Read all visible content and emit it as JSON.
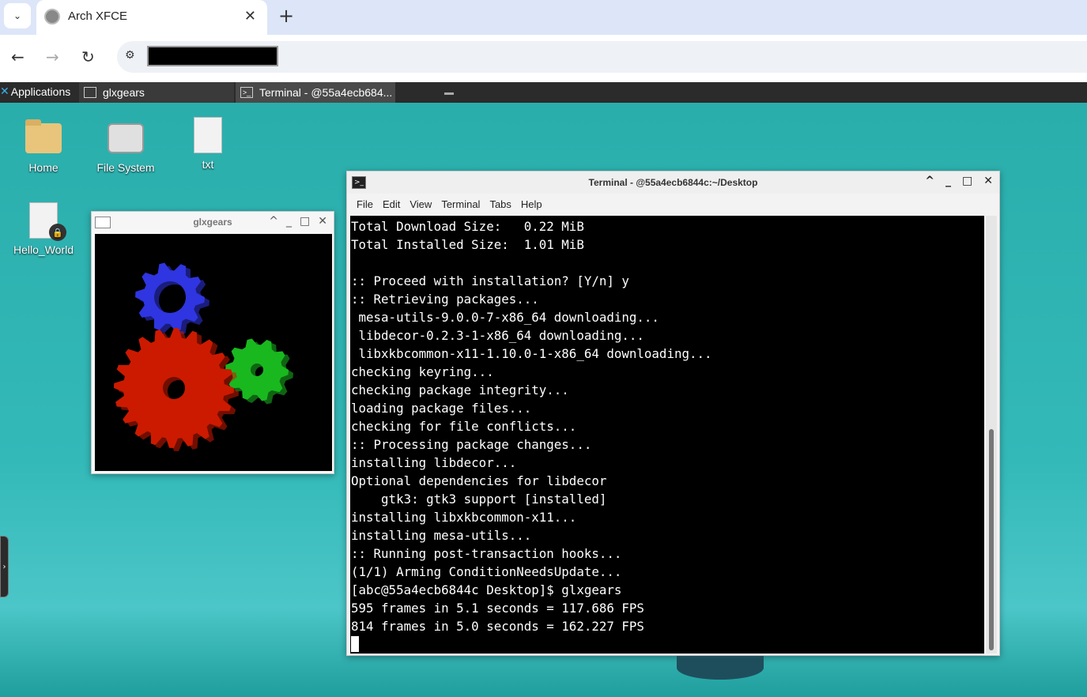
{
  "browser": {
    "tab_title": "Arch XFCE",
    "tab_close": "✕",
    "new_tab": "+",
    "tab_search": "⌄",
    "back": "←",
    "forward": "→",
    "reload": "↻",
    "site_info": "⚙"
  },
  "panel": {
    "applications_label": "Applications",
    "tasks": [
      {
        "label": "glxgears"
      },
      {
        "label": "Terminal - @55a4ecb684..."
      }
    ]
  },
  "desktop": {
    "icons": [
      {
        "label": "Home"
      },
      {
        "label": "File System"
      },
      {
        "label": "txt"
      },
      {
        "label": "Hello_World"
      }
    ]
  },
  "glxgears_window": {
    "title": "glxgears",
    "controls": [
      "^",
      "_",
      "□",
      "✕"
    ]
  },
  "terminal_window": {
    "title": "Terminal - @55a4ecb6844c:~/Desktop",
    "controls": [
      "^",
      "_",
      "□",
      "✕"
    ],
    "menu": [
      "File",
      "Edit",
      "View",
      "Terminal",
      "Tabs",
      "Help"
    ],
    "lines": [
      "Total Download Size:   0.22 MiB",
      "Total Installed Size:  1.01 MiB",
      "",
      ":: Proceed with installation? [Y/n] y",
      ":: Retrieving packages...",
      " mesa-utils-9.0.0-7-x86_64 downloading...",
      " libdecor-0.2.3-1-x86_64 downloading...",
      " libxkbcommon-x11-1.10.0-1-x86_64 downloading...",
      "checking keyring...",
      "checking package integrity...",
      "loading package files...",
      "checking for file conflicts...",
      ":: Processing package changes...",
      "installing libdecor...",
      "Optional dependencies for libdecor",
      "    gtk3: gtk3 support [installed]",
      "installing libxkbcommon-x11...",
      "installing mesa-utils...",
      ":: Running post-transaction hooks...",
      "(1/1) Arming ConditionNeedsUpdate...",
      "[abc@55a4ecb6844c Desktop]$ glxgears",
      "595 frames in 5.1 seconds = 117.686 FPS",
      "814 frames in 5.0 seconds = 162.227 FPS"
    ]
  },
  "colors": {
    "gear_red": "#cc1a00",
    "gear_green": "#19b81f",
    "gear_blue": "#2f35e0"
  }
}
